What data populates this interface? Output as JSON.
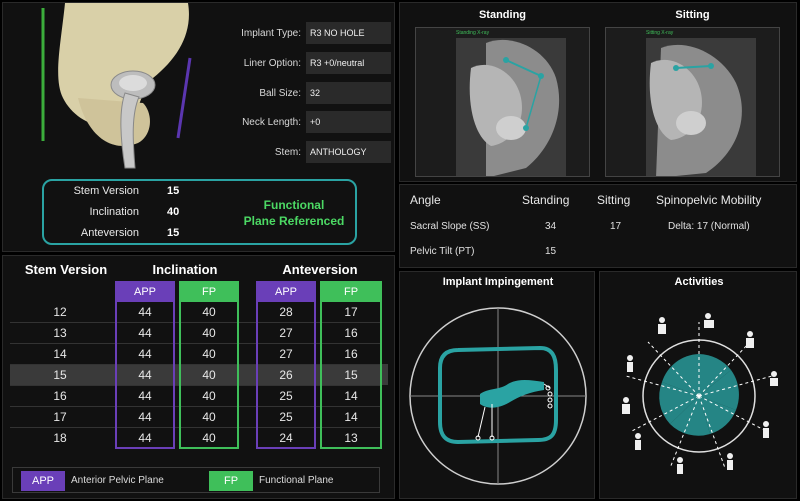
{
  "implant": {
    "fields": [
      {
        "label": "Implant Type:",
        "value": "R3 NO HOLE"
      },
      {
        "label": "Liner Option:",
        "value": "R3 +0/neutral"
      },
      {
        "label": "Ball Size:",
        "value": "32"
      },
      {
        "label": "Neck Length:",
        "value": "+0"
      },
      {
        "label": "Stem:",
        "value": "ANTHOLOGY"
      }
    ],
    "angles": [
      {
        "label": "Stem Version",
        "value": "15"
      },
      {
        "label": "Inclination",
        "value": "40"
      },
      {
        "label": "Anteversion",
        "value": "15"
      }
    ],
    "reference_line1": "Functional",
    "reference_line2": "Plane Referenced"
  },
  "version_table": {
    "headers": {
      "stem_version": "Stem Version",
      "inclination": "Inclination",
      "anteversion": "Anteversion"
    },
    "sub_app": "APP",
    "sub_fp": "FP",
    "rows": [
      {
        "stem": "12",
        "inc_app": "44",
        "inc_fp": "40",
        "ant_app": "28",
        "ant_fp": "17"
      },
      {
        "stem": "13",
        "inc_app": "44",
        "inc_fp": "40",
        "ant_app": "27",
        "ant_fp": "16"
      },
      {
        "stem": "14",
        "inc_app": "44",
        "inc_fp": "40",
        "ant_app": "27",
        "ant_fp": "16"
      },
      {
        "stem": "15",
        "inc_app": "44",
        "inc_fp": "40",
        "ant_app": "26",
        "ant_fp": "15"
      },
      {
        "stem": "16",
        "inc_app": "44",
        "inc_fp": "40",
        "ant_app": "25",
        "ant_fp": "14"
      },
      {
        "stem": "17",
        "inc_app": "44",
        "inc_fp": "40",
        "ant_app": "25",
        "ant_fp": "14"
      },
      {
        "stem": "18",
        "inc_app": "44",
        "inc_fp": "40",
        "ant_app": "24",
        "ant_fp": "13"
      }
    ],
    "legend": {
      "app_badge": "APP",
      "app_text": "Anterior Pelvic Plane",
      "fp_badge": "FP",
      "fp_text": "Functional Plane"
    }
  },
  "xrays": {
    "standing_title": "Standing",
    "sitting_title": "Sitting",
    "standing_tag": "Standing X-ray",
    "sitting_tag": "Sitting X-ray"
  },
  "spinopelvic": {
    "headers": {
      "angle": "Angle",
      "standing": "Standing",
      "sitting": "Sitting",
      "mobility": "Spinopelvic Mobility"
    },
    "rows": [
      {
        "angle": "Sacral Slope (SS)",
        "standing": "34",
        "sitting": "17",
        "mobility": "Delta: 17 (Normal)"
      },
      {
        "angle": "Pelvic Tilt (PT)",
        "standing": "15",
        "sitting": "",
        "mobility": ""
      }
    ]
  },
  "impingement": {
    "title": "Implant Impingement"
  },
  "activities": {
    "title": "Activities"
  },
  "colors": {
    "app_purple": "#6a3fb8",
    "fp_green": "#3fbf5a",
    "teal": "#2aa3a3",
    "functional_green": "#4cd964"
  }
}
